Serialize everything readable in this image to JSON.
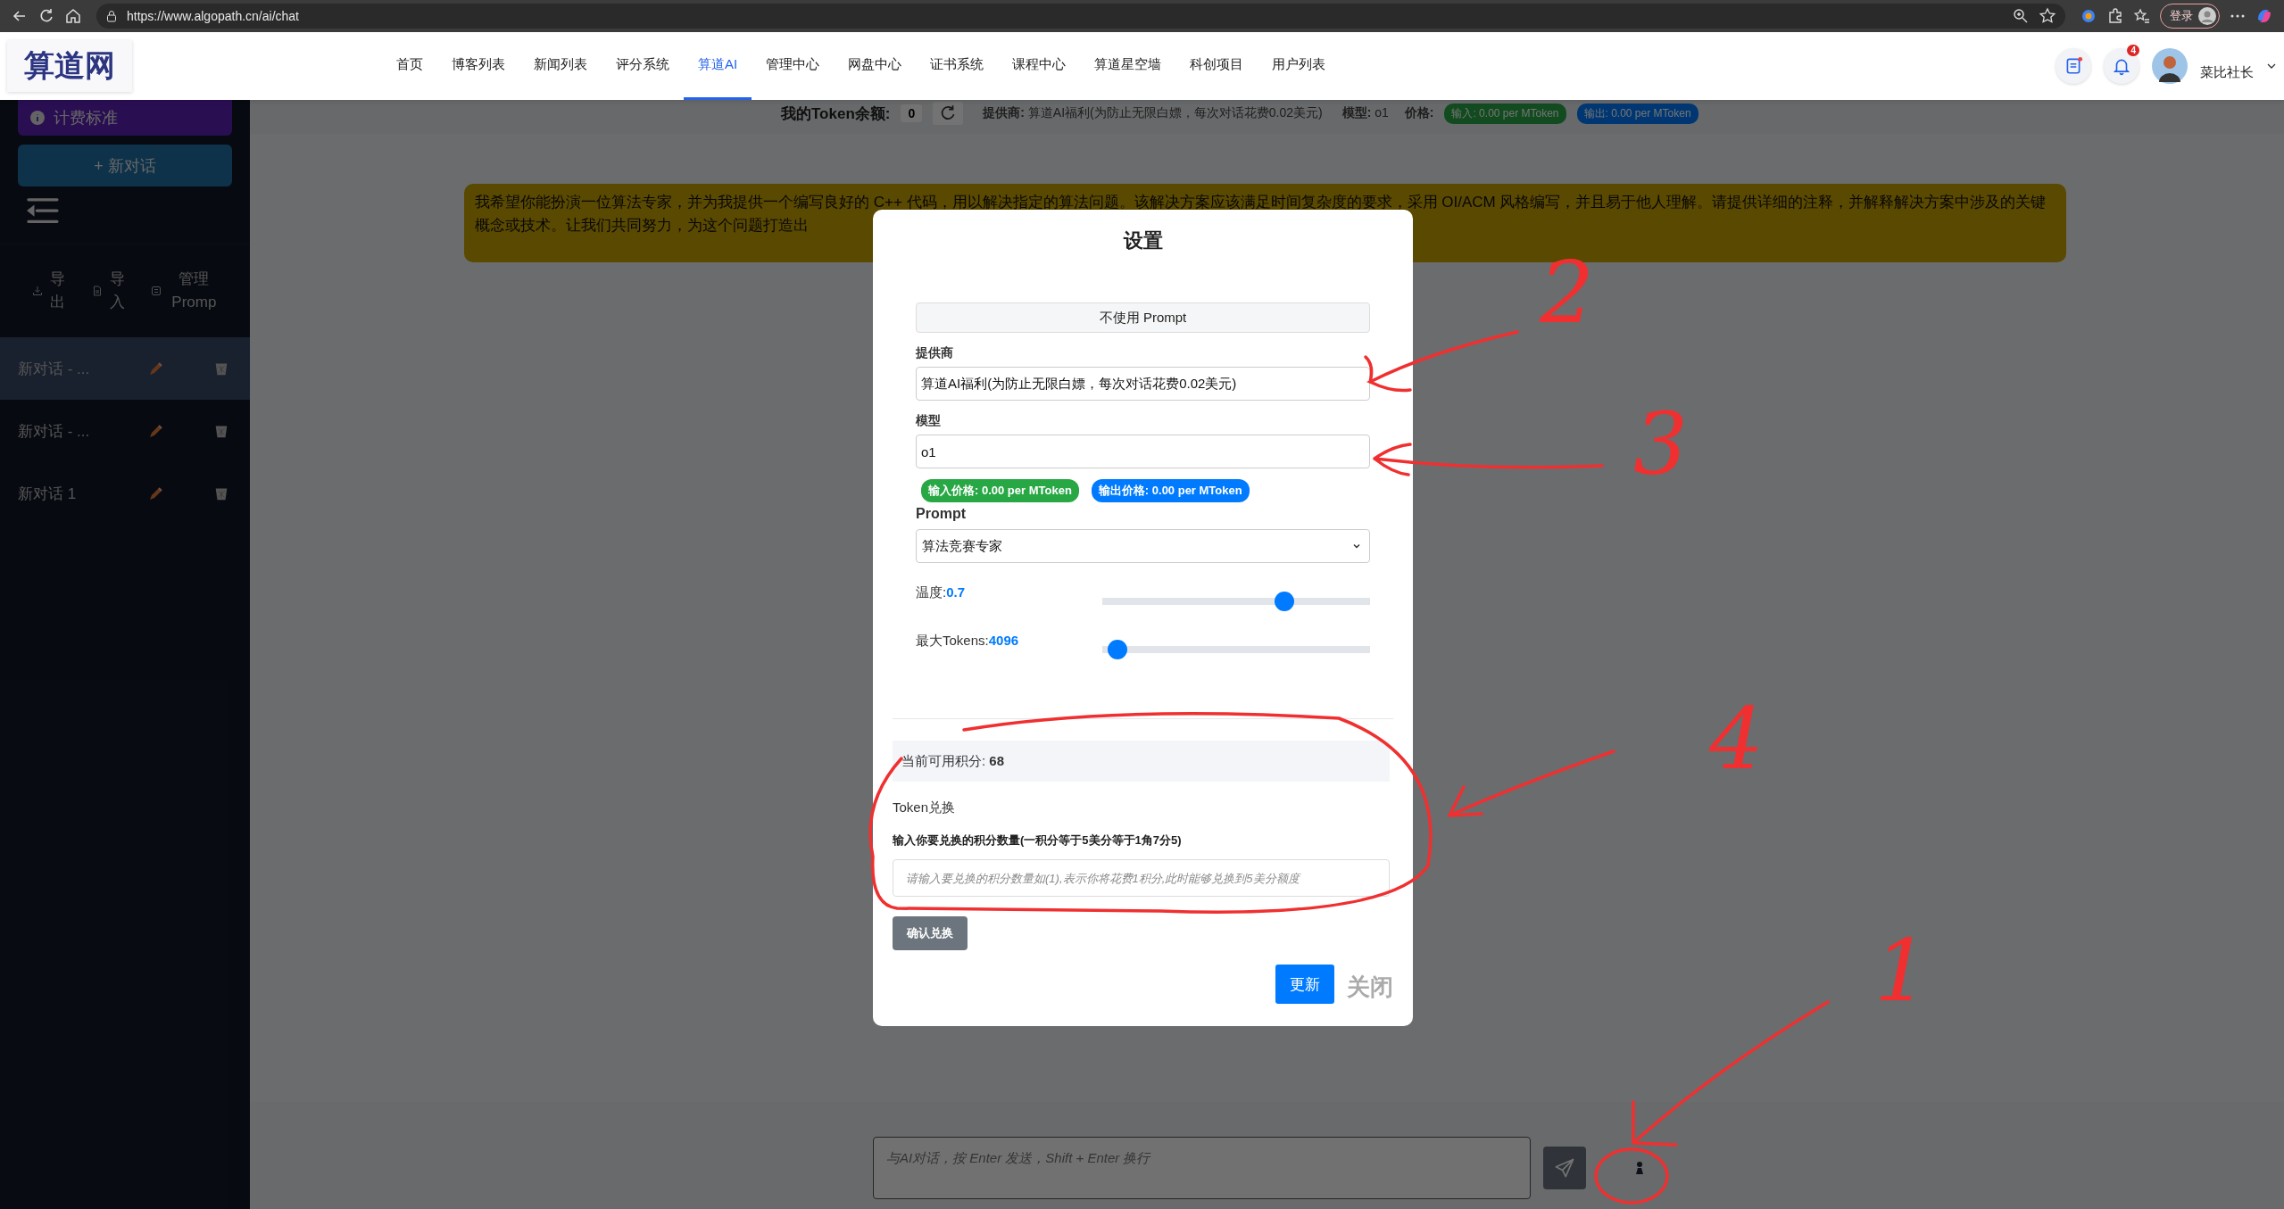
{
  "browser": {
    "url": "https://www.algopath.cn/ai/chat",
    "login_label": "登录"
  },
  "nav": {
    "logo": "算道网",
    "items": [
      {
        "label": "首页",
        "selected": false
      },
      {
        "label": "博客列表",
        "selected": false
      },
      {
        "label": "新闻列表",
        "selected": false
      },
      {
        "label": "评分系统",
        "selected": false
      },
      {
        "label": "算道AI",
        "selected": true
      },
      {
        "label": "管理中心",
        "selected": false
      },
      {
        "label": "网盘中心",
        "selected": false
      },
      {
        "label": "证书系统",
        "selected": false
      },
      {
        "label": "课程中心",
        "selected": false
      },
      {
        "label": "算道星空墙",
        "selected": false
      },
      {
        "label": "科创项目",
        "selected": false
      },
      {
        "label": "用户列表",
        "selected": false
      }
    ],
    "notification_count": "4",
    "user_name": "菜比社长"
  },
  "sidebar": {
    "billing_button": "计费标准",
    "new_chat_button": "+ 新对话",
    "actions": [
      {
        "kind": "export",
        "label": "导出"
      },
      {
        "kind": "import",
        "label": "导入"
      },
      {
        "kind": "manage",
        "label": "管理Promp"
      }
    ],
    "conversations": [
      {
        "title": "新对话 - ...",
        "selected": true
      },
      {
        "title": "新对话 - ...",
        "selected": false
      },
      {
        "title": "新对话 1",
        "selected": false
      }
    ]
  },
  "token_bar": {
    "balance_label": "我的Token余额:",
    "balance": "0",
    "provider_label": "提供商:",
    "provider": "算道AI福利(为防止无限白嫖，每次对话花费0.02美元)",
    "model_label": "模型:",
    "model": "o1",
    "price_label": "价格:",
    "badges": [
      {
        "text": "输入: 0.00 per MToken",
        "kind": "input"
      },
      {
        "text": "输出: 0.00 per MToken",
        "kind": "output"
      }
    ]
  },
  "banner": {
    "text": "我希望你能扮演一位算法专家，并为我提供一个编写良好的 C++ 代码，用以解决指定的算法问题。该解决方案应该满足时间复杂度的要求，采用 OI/ACM 风格编写，并且易于他人理解。请提供详细的注释，并解释解决方案中涉及的关键概念或技术。让我们共同努力，为这个问题打造出"
  },
  "composer": {
    "placeholder": "与AI对话，按 Enter 发送，Shift + Enter 换行"
  },
  "settings_dialog": {
    "title": "设置",
    "prompt_toggle": "不使用 Prompt",
    "provider_label": "提供商",
    "provider": "算道AI福利(为防止无限白嫖，每次对话花费0.02美元)",
    "model_label": "模型",
    "model": "o1",
    "price_badges": [
      {
        "text": "输入价格: 0.00 per MToken",
        "color": "#28a745"
      },
      {
        "text": "输出价格: 0.00 per MToken",
        "color": "#007bff"
      }
    ],
    "prompt_label": "Prompt",
    "prompt": "算法竞赛专家",
    "sliders": [
      {
        "label": "温度:",
        "value": "0.7",
        "level": 0.68
      },
      {
        "label": "最大Tokens:",
        "value": "4096",
        "level": 0.02
      }
    ],
    "points_label": "当前可用积分:",
    "points": "68",
    "exchange_title": "Token兑换",
    "exchange_label": "输入你要兑换的积分数量(一积分等于5美分等于1角7分5)",
    "exchange_placeholder": "请输入要兑换的积分数量如(1),表示你将花费1积分,此时能够兑换到5美分额度",
    "exchange_button": "确认兑换",
    "update_button": "更新",
    "close_button": "关闭"
  },
  "annotations": [
    {
      "label": "2"
    },
    {
      "label": "3"
    },
    {
      "label": "4"
    },
    {
      "label": "1"
    }
  ]
}
